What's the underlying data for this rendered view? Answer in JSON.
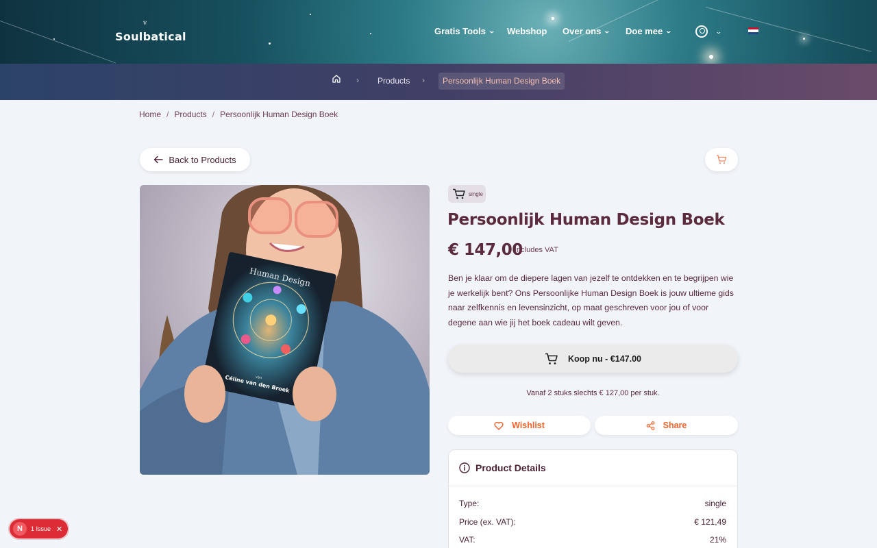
{
  "header": {
    "logo": "Soulbatical",
    "nav": [
      {
        "label": "Gratis Tools",
        "has_dropdown": true
      },
      {
        "label": "Webshop",
        "has_dropdown": false
      },
      {
        "label": "Over ons",
        "has_dropdown": true
      },
      {
        "label": "Doe mee",
        "has_dropdown": true
      }
    ],
    "language_flag": "nl-flag-icon"
  },
  "subnav": {
    "products": "Products",
    "current": "Persoonlijk Human Design Boek"
  },
  "breadcrumb": {
    "home": "Home",
    "products": "Products",
    "current": "Persoonlijk Human Design Boek"
  },
  "back_button": "Back to Products",
  "product": {
    "type_badge": "single",
    "title": "Persoonlijk Human Design Boek",
    "price": "€ 147,00",
    "vat_note": "Includes VAT",
    "description": "Ben je klaar om de diepere lagen van jezelf te ontdekken en te begrijpen wie je werkelijk bent? Ons Persoonlijke Human Design Boek is jouw ultieme gids naar zelfkennis en levensinzicht, op maat geschreven voor jou of voor degene aan wie jij het boek cadeau wilt geven.",
    "buy_label": "Koop nu - €147.00",
    "bulk_note": "Vanaf 2 stuks slechts € 127,00 per stuk.",
    "wishlist_label": "Wishlist",
    "share_label": "Share",
    "book_title": "Human Design",
    "book_author_prefix": "van",
    "book_author": "Céline van den Broek"
  },
  "details": {
    "heading": "Product Details",
    "rows": [
      {
        "label": "Type:",
        "value": "single"
      },
      {
        "label": "Price (ex. VAT):",
        "value": "€ 121,49"
      },
      {
        "label": "VAT:",
        "value": "21%"
      }
    ]
  },
  "issue_badge": {
    "letter": "N",
    "text": "1 Issue"
  },
  "colors": {
    "accent": "#f0622a",
    "text": "#5b2a3c",
    "background": "#f1f4f8"
  }
}
